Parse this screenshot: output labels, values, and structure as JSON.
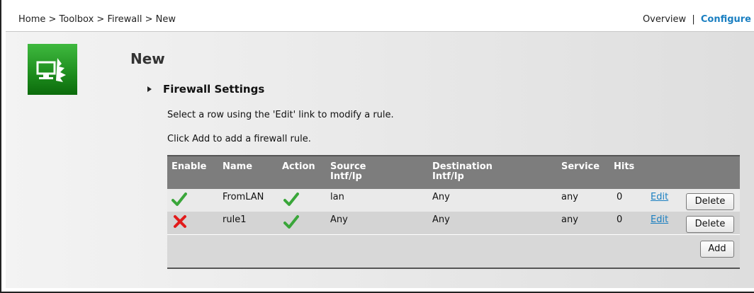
{
  "breadcrumb": "Home > Toolbox > Firewall > New",
  "nav": {
    "overview": "Overview",
    "separator": "|",
    "configure": "Configure"
  },
  "page": {
    "title": "New"
  },
  "section": {
    "title": "Firewall Settings"
  },
  "instructions": [
    "Select a row using the 'Edit' link to modify a rule.",
    "Click Add to add a firewall rule."
  ],
  "table": {
    "headers": {
      "enable": "Enable",
      "name": "Name",
      "action": "Action",
      "source_line1": "Source",
      "source_line2": "Intf/Ip",
      "dest_line1": "Destination",
      "dest_line2": "Intf/Ip",
      "service": "Service",
      "hits": "Hits"
    },
    "rows": [
      {
        "enable": "check",
        "name": "FromLAN",
        "action": "check",
        "source": "lan",
        "destination": "Any",
        "service": "any",
        "hits": "0",
        "edit": "Edit",
        "delete": "Delete"
      },
      {
        "enable": "cross",
        "name": "rule1",
        "action": "check",
        "source": "Any",
        "destination": "Any",
        "service": "any",
        "hits": "0",
        "edit": "Edit",
        "delete": "Delete"
      }
    ],
    "add_label": "Add"
  },
  "colors": {
    "link": "#1a7fc1",
    "check": "#3aa63a",
    "cross": "#e21b1b",
    "header_bg": "#7d7d7d"
  },
  "icons": {
    "logo": "firewall-computer-icon",
    "enabled": "check-icon",
    "disabled": "cross-icon"
  }
}
